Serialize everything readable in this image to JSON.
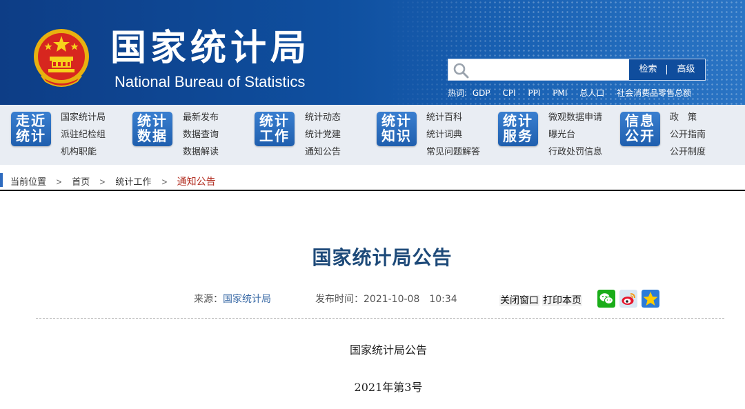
{
  "header": {
    "title": "国家统计局",
    "subtitle": "National Bureau of Statistics",
    "search": {
      "placeholder": "",
      "button_search": "检索",
      "button_advanced": "高级"
    },
    "hot": {
      "label": "热词:",
      "items": [
        "GDP",
        "CPI",
        "PPI",
        "PMI",
        "总人口",
        "社会消费品零售总额"
      ]
    }
  },
  "nav": [
    {
      "badge": [
        "走近",
        "统计"
      ],
      "links": [
        "国家统计局",
        "派驻纪检组",
        "机构职能"
      ]
    },
    {
      "badge": [
        "统计",
        "数据"
      ],
      "links": [
        "最新发布",
        "数据查询",
        "数据解读"
      ]
    },
    {
      "badge": [
        "统计",
        "工作"
      ],
      "links": [
        "统计动态",
        "统计党建",
        "通知公告"
      ]
    },
    {
      "badge": [
        "统计",
        "知识"
      ],
      "links": [
        "统计百科",
        "统计词典",
        "常见问题解答"
      ]
    },
    {
      "badge": [
        "统计",
        "服务"
      ],
      "links": [
        "微观数据申请",
        "曝光台",
        "行政处罚信息"
      ]
    },
    {
      "badge": [
        "信息",
        "公开"
      ],
      "links": [
        "政　策",
        "公开指南",
        "公开制度"
      ]
    }
  ],
  "breadcrumb": {
    "label": "当前位置",
    "items": [
      "首页",
      "统计工作",
      "通知公告"
    ]
  },
  "article": {
    "title": "国家统计局公告",
    "source_label": "来源：",
    "source": "国家统计局",
    "time_label": "发布时间：",
    "time": "2021-10-08　10:34",
    "close_window": "关闭窗口",
    "print_page": "打印本页",
    "body_heading": "国家统计局公告",
    "body_number": "2021年第3号"
  },
  "colors": {
    "header_blue": "#0f4f9f",
    "title_blue": "#1e4a79",
    "breadcrumb_current": "#b22d20"
  }
}
